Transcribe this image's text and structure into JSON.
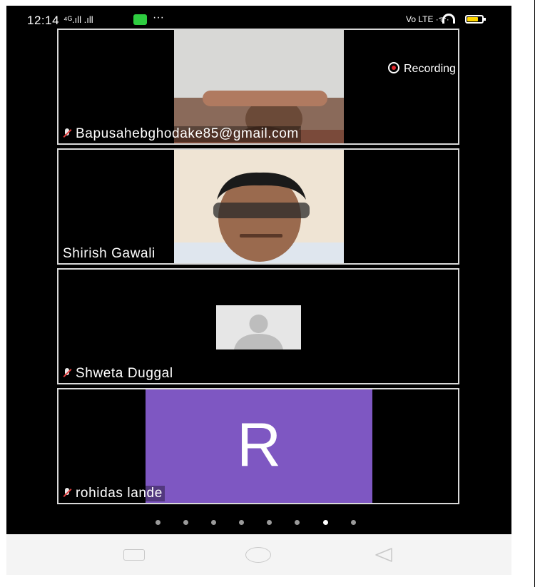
{
  "status_bar": {
    "time": "12:14",
    "signal_text": "⁴ᴳ.ıll .ıll",
    "more": "···",
    "right_text": "Vo LTE  ·ᯤ·"
  },
  "recording": {
    "label": "Recording"
  },
  "participants": [
    {
      "name": "Bapusahebghodake85@gmail.com",
      "muted": true,
      "video": "camera"
    },
    {
      "name": "Shirish Gawali",
      "muted": false,
      "video": "camera"
    },
    {
      "name": "Shweta Duggal",
      "muted": true,
      "video": "placeholder"
    },
    {
      "name": "rohidas lande",
      "muted": true,
      "video": "initial",
      "initial": "R",
      "avatar_color": "#7e57c2"
    }
  ],
  "pager": {
    "total": 8,
    "active_index": 6
  },
  "nav_bar": {
    "icons": [
      "recents-icon",
      "home-icon",
      "back-icon"
    ]
  }
}
